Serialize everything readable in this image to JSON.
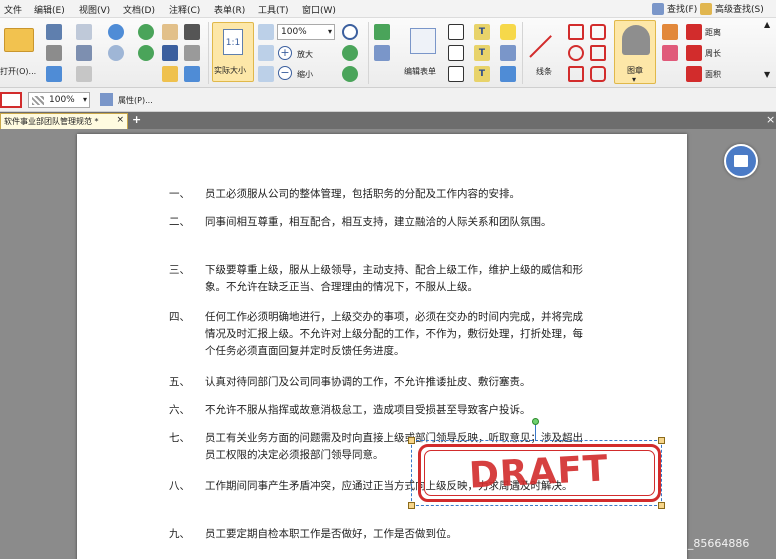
{
  "menu": {
    "items": [
      "文件",
      "编辑(E)",
      "视图(V)",
      "文档(D)",
      "注释(C)",
      "表单(R)",
      "工具(T)",
      "窗口(W)"
    ],
    "find": "查找(F)",
    "advanced_find": "高级查找(S)"
  },
  "ribbon": {
    "open_label": "打开(O)...",
    "actual_size_label": "实际大小",
    "zoom_value": "100%",
    "zoom_in_label": "放大",
    "zoom_out_label": "缩小",
    "edit_form_label": "编辑表单",
    "lines_label": "线条",
    "stamp_label": "图章",
    "distance_label": "距离",
    "perimeter_label": "周长",
    "area_label": "面积"
  },
  "propbar": {
    "opacity_value": "100%",
    "properties_label": "属性(P)..."
  },
  "tab": {
    "title": "软件事业部团队管理规范 *",
    "close": "×",
    "add": "+"
  },
  "document": {
    "clauses": [
      {
        "num": "一、",
        "text": "员工必须服从公司的整体管理，包括职务的分配及工作内容的安排。"
      },
      {
        "num": "二、",
        "text": "同事间相互尊重，相互配合，相互支持，建立融洽的人际关系和团队氛围。"
      },
      {
        "num": "三、",
        "text": "下级要尊重上级，服从上级领导，主动支持、配合上级工作，维护上级的威信和形象。不允许在缺乏正当、合理理由的情况下，不服从上级。"
      },
      {
        "num": "四、",
        "text": "任何工作必须明确地进行，上级交办的事项，必须在交办的时间内完成，并将完成情况及时汇报上级。不允许对上级分配的工作，不作为，敷衍处理，打折处理，每个任务必须直面回复并定时反馈任务进度。"
      },
      {
        "num": "五、",
        "text": "认真对待同部门及公司同事协调的工作，不允许推诿扯皮、敷衍塞责。"
      },
      {
        "num": "六、",
        "text": "不允许不服从指挥或故意消极怠工，造成项目受损甚至导致客户投诉。"
      },
      {
        "num": "七、",
        "text": "员工有关业务方面的问题需及时向直接上级或部门领导反映，听取意见；涉及超出员工权限的决定必须报部门领导同意。"
      },
      {
        "num": "八、",
        "text": "工作期间同事产生矛盾冲突，应通过正当方式向上级反映，力求周遇及时解决。"
      },
      {
        "num": "九、",
        "text": "员工要定期自检本职工作是否做好，工作是否做到位。"
      }
    ],
    "stamp_text": "DRAFT"
  },
  "watermark": "CSDN @2401_85664886",
  "colors": {
    "stamp": "#d22c2c",
    "selection": "#3a78c8",
    "float_button": "#4b7bc6",
    "workspace": "#8b8b8b"
  }
}
